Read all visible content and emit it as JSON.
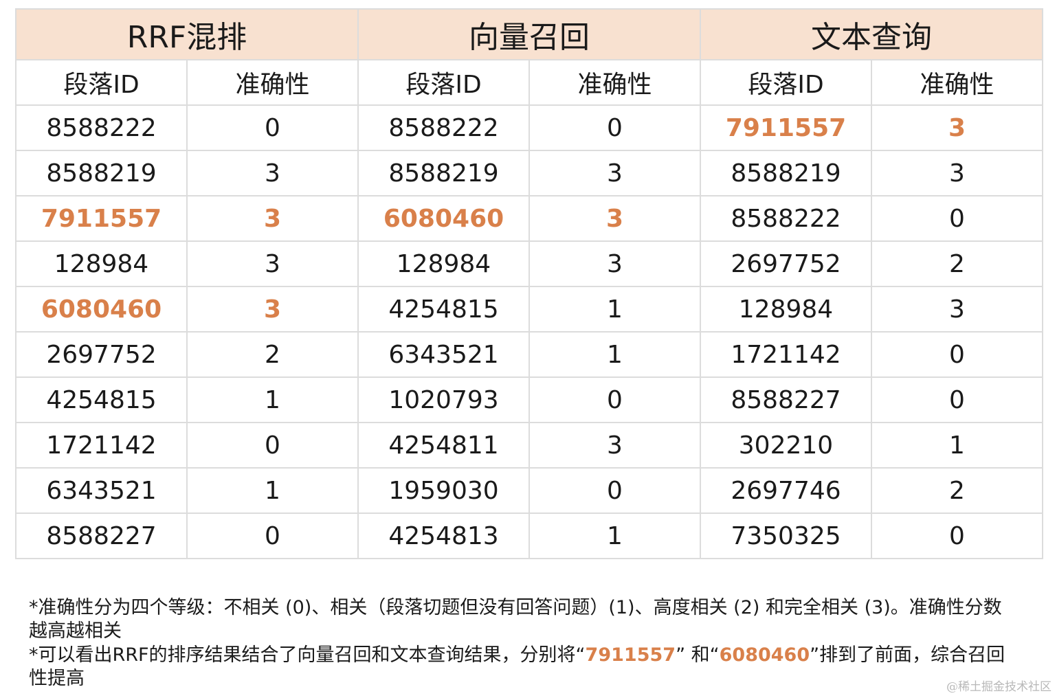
{
  "groups": [
    "RRF混排",
    "向量召回",
    "文本查询"
  ],
  "subheaders": [
    "段落ID",
    "准确性",
    "段落ID",
    "准确性",
    "段落ID",
    "准确性"
  ],
  "rows": [
    [
      "8588222",
      "0",
      "8588222",
      "0",
      "7911557",
      "3"
    ],
    [
      "8588219",
      "3",
      "8588219",
      "3",
      "8588219",
      "3"
    ],
    [
      "7911557",
      "3",
      "6080460",
      "3",
      "8588222",
      "0"
    ],
    [
      "128984",
      "3",
      "128984",
      "3",
      "2697752",
      "2"
    ],
    [
      "6080460",
      "3",
      "4254815",
      "1",
      "128984",
      "3"
    ],
    [
      "2697752",
      "2",
      "6343521",
      "1",
      "1721142",
      "0"
    ],
    [
      "4254815",
      "1",
      "1020793",
      "0",
      "8588227",
      "0"
    ],
    [
      "1721142",
      "0",
      "4254811",
      "3",
      "302210",
      "1"
    ],
    [
      "6343521",
      "1",
      "1959030",
      "0",
      "2697746",
      "2"
    ],
    [
      "8588227",
      "0",
      "4254813",
      "1",
      "7350325",
      "0"
    ]
  ],
  "highlight_ids": [
    "7911557",
    "6080460"
  ],
  "colors": {
    "header_bg": "#f8e1d0",
    "highlight": "#d9804a",
    "border": "#dcdcdc"
  },
  "notes": {
    "note1": "*准确性分为四个等级：不相关 (0)、相关（段落切题但没有回答问题）(1)、高度相关 (2) 和完全相关 (3)。准确性分数越高越相关",
    "note2_a": "*可以看出RRF的排序结果结合了向量召回和文本查询结果，分别将“",
    "note2_id1": "7911557",
    "note2_b": "” 和“",
    "note2_id2": "6080460",
    "note2_c": "”排到了前面，综合召回性提高"
  },
  "watermark": "@稀土掘金技术社区"
}
